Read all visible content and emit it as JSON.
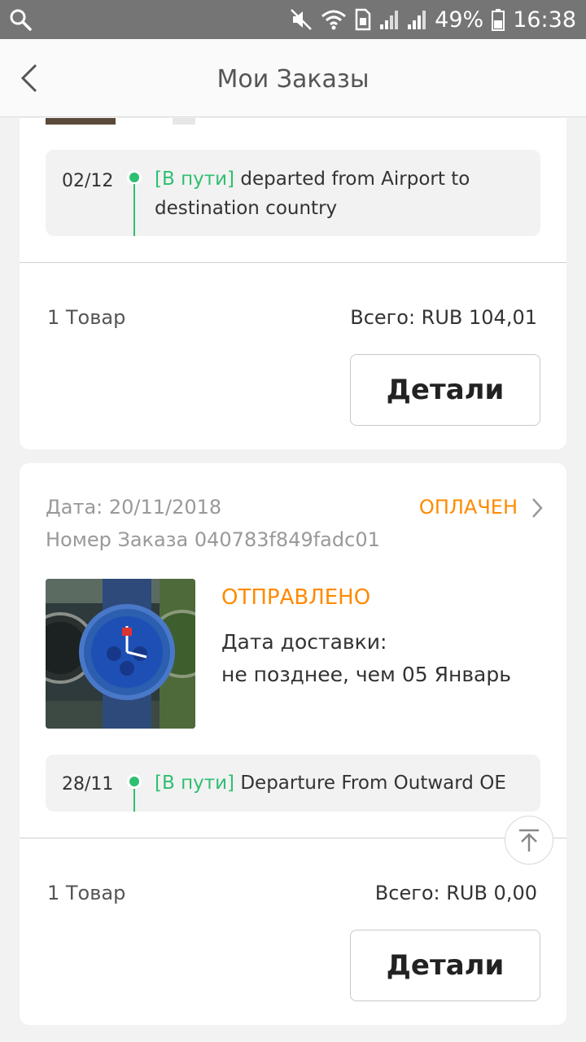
{
  "status_bar": {
    "battery": "49%",
    "time": "16:38"
  },
  "app_bar": {
    "title": "Мои Заказы"
  },
  "orders": [
    {
      "tracking": {
        "date": "02/12",
        "status": "[В пути]",
        "message": "departed from Airport to destination country"
      },
      "count": "1 Товар",
      "total": "Всего: RUB 104,01",
      "details_label": "Детали"
    },
    {
      "date_label": "Дата: 20/11/2018",
      "order_number": "Номер Заказа 040783f849fadc01",
      "payment_status": "ОПЛАЧЕН",
      "shipping_status": "ОТПРАВЛЕНО",
      "delivery_label": "Дата доставки:",
      "delivery_date": "не позднее, чем 05 Январь",
      "tracking": {
        "date": "28/11",
        "status": "[В пути]",
        "message": "Departure From Outward OE"
      },
      "count": "1 Товар",
      "total": "Всего: RUB 0,00",
      "details_label": "Детали"
    }
  ],
  "colors": {
    "accent_green": "#2fbf71",
    "accent_orange": "#ff8a00"
  }
}
